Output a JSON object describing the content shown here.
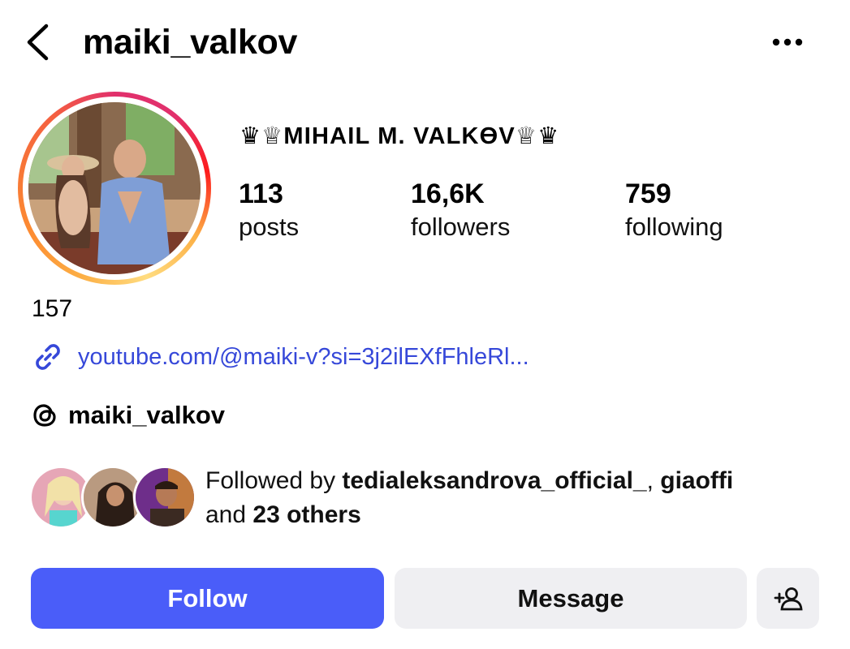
{
  "header": {
    "username": "maiki_valkov",
    "back_icon": "chevron-left-icon",
    "more_icon": "ellipsis-horizontal-icon"
  },
  "profile": {
    "display_name": "♛♕MIHAIL M. VALKӨV♕♛",
    "stats": [
      {
        "value": "113",
        "label": "posts"
      },
      {
        "value": "16,6K",
        "label": "followers"
      },
      {
        "value": "759",
        "label": "following"
      }
    ],
    "bio_line": "157",
    "link": {
      "icon": "link-icon",
      "text": "youtube.com/@maiki-v?si=3j2ilEXfFhleRl..."
    },
    "threads": {
      "icon": "threads-icon",
      "handle": "maiki_valkov"
    }
  },
  "followed_by": {
    "prefix": "Followed by ",
    "user1": "tedialeksandrova_official_",
    "separator": ", ",
    "user2": "giaoffi",
    "middle": "and ",
    "others": "23 others"
  },
  "actions": {
    "follow_label": "Follow",
    "message_label": "Message",
    "add_user_icon": "add-person-icon"
  },
  "colors": {
    "follow_button": "#4a5df9",
    "secondary_button": "#efeff2",
    "link": "#3648d9"
  }
}
